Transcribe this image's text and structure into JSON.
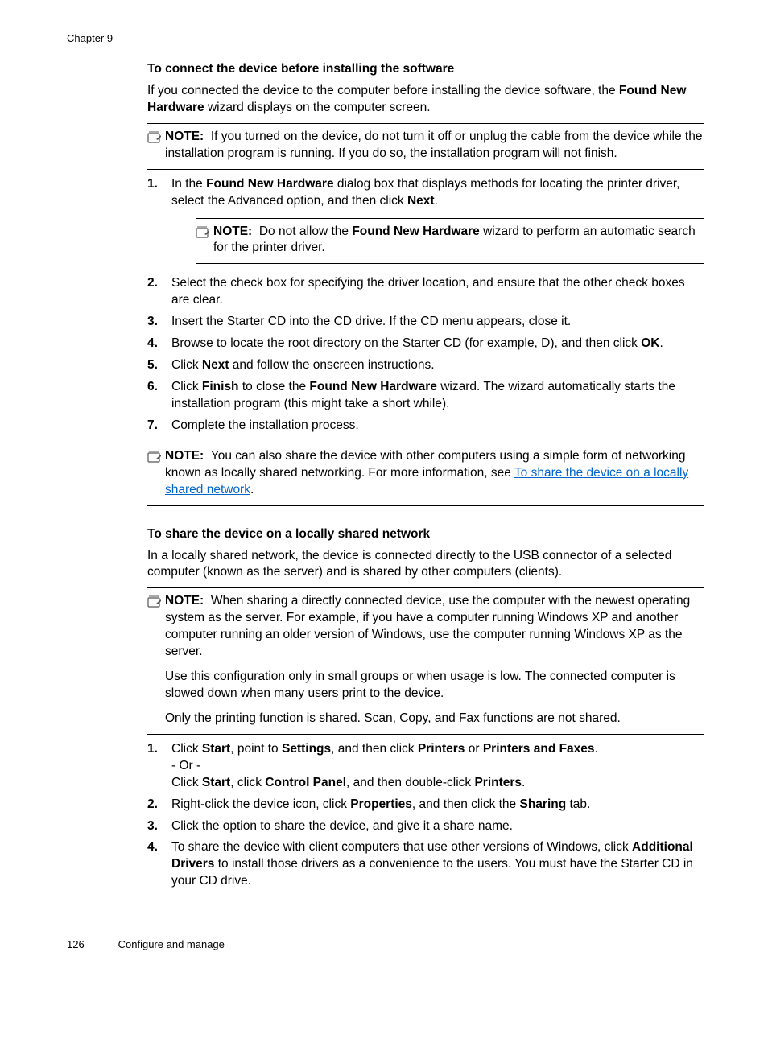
{
  "header": {
    "chapter": "Chapter 9"
  },
  "section1": {
    "heading": "To connect the device before installing the software",
    "intro": {
      "pre1": "If you connected the device to the computer before installing the device software, the ",
      "b1": "Found New Hardware",
      "post1": " wizard displays on the computer screen."
    },
    "note1": {
      "label": "NOTE:",
      "text": "If you turned on the device, do not turn it off or unplug the cable from the device while the installation program is running. If you do so, the installation program will not finish."
    },
    "steps": {
      "s1": {
        "num": "1.",
        "pre1": "In the ",
        "b1": "Found New Hardware",
        "mid1": " dialog box that displays methods for locating the printer driver, select the Advanced option, and then click ",
        "b2": "Next",
        "post1": "."
      },
      "s1note": {
        "label": "NOTE:",
        "pre1": "Do not allow the ",
        "b1": "Found New Hardware",
        "post1": " wizard to perform an automatic search for the printer driver."
      },
      "s2": {
        "num": "2.",
        "text": "Select the check box for specifying the driver location, and ensure that the other check boxes are clear."
      },
      "s3": {
        "num": "3.",
        "text": "Insert the Starter CD into the CD drive. If the CD menu appears, close it."
      },
      "s4": {
        "num": "4.",
        "pre1": "Browse to locate the root directory on the Starter CD (for example, D), and then click ",
        "b1": "OK",
        "post1": "."
      },
      "s5": {
        "num": "5.",
        "pre1": "Click ",
        "b1": "Next",
        "post1": " and follow the onscreen instructions."
      },
      "s6": {
        "num": "6.",
        "pre1": "Click ",
        "b1": "Finish",
        "mid1": " to close the ",
        "b2": "Found New Hardware",
        "post1": " wizard. The wizard automatically starts the installation program (this might take a short while)."
      },
      "s7": {
        "num": "7.",
        "text": "Complete the installation process."
      }
    },
    "note2": {
      "label": "NOTE:",
      "pre1": "You can also share the device with other computers using a simple form of networking known as locally shared networking. For more information, see ",
      "link": "To share the device on a locally shared network",
      "post1": "."
    }
  },
  "section2": {
    "heading": "To share the device on a locally shared network",
    "intro": "In a locally shared network, the device is connected directly to the USB connector of a selected computer (known as the server) and is shared by other computers (clients).",
    "note": {
      "label": "NOTE:",
      "p1": "When sharing a directly connected device, use the computer with the newest operating system as the server. For example, if you have a computer running Windows XP and another computer running an older version of Windows, use the computer running Windows XP as the server.",
      "p2": "Use this configuration only in small groups or when usage is low. The connected computer is slowed down when many users print to the device.",
      "p3": "Only the printing function is shared. Scan, Copy, and Fax functions are not shared."
    },
    "steps": {
      "s1": {
        "num": "1.",
        "l1_pre": "Click ",
        "l1_b1": "Start",
        "l1_mid1": ", point to ",
        "l1_b2": "Settings",
        "l1_mid2": ", and then click ",
        "l1_b3": "Printers",
        "l1_mid3": " or ",
        "l1_b4": "Printers and Faxes",
        "l1_post": ".",
        "l2": "- Or -",
        "l3_pre": "Click ",
        "l3_b1": "Start",
        "l3_mid1": ", click ",
        "l3_b2": "Control Panel",
        "l3_mid2": ", and then double-click ",
        "l3_b3": "Printers",
        "l3_post": "."
      },
      "s2": {
        "num": "2.",
        "pre1": "Right-click the device icon, click ",
        "b1": "Properties",
        "mid1": ", and then click the ",
        "b2": "Sharing",
        "post1": " tab."
      },
      "s3": {
        "num": "3.",
        "text": "Click the option to share the device, and give it a share name."
      },
      "s4": {
        "num": "4.",
        "pre1": "To share the device with client computers that use other versions of Windows, click ",
        "b1": "Additional Drivers",
        "post1": " to install those drivers as a convenience to the users. You must have the Starter CD in your CD drive."
      }
    }
  },
  "footer": {
    "page": "126",
    "section": "Configure and manage"
  }
}
